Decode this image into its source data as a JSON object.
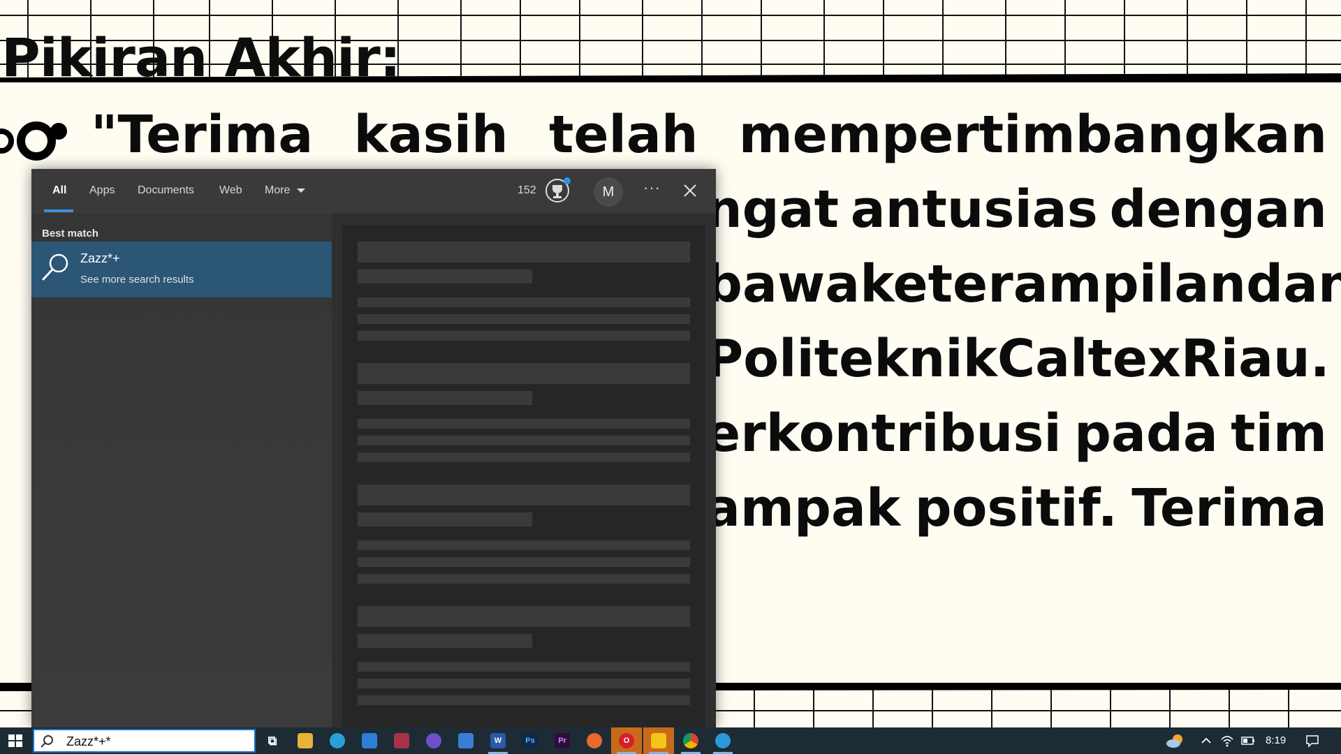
{
  "slide": {
    "heading": "Pikiran Akhir:",
    "line1": [
      "\"Terima",
      "kasih",
      "telah",
      "mempertimbangkan"
    ],
    "line2": [
      "ngat",
      "antusias",
      "dengan"
    ],
    "line3": [
      "bawa",
      "keterampilan",
      "dan"
    ],
    "line4": [
      "Politeknik",
      "Caltex",
      "Riau."
    ],
    "line5": [
      "erkontribusi",
      "pada",
      "tim"
    ],
    "line6": [
      "ampak",
      "positif.",
      "Terima"
    ]
  },
  "search_panel": {
    "tabs": [
      "All",
      "Apps",
      "Documents",
      "Web",
      "More"
    ],
    "points": "152",
    "avatar_initial": "M",
    "more_dots": "···",
    "best_match_label": "Best match",
    "result_title": "Zazz*+",
    "result_subtitle": "See more search results"
  },
  "taskbar": {
    "search_query": "Zazz*+*",
    "apps": [
      {
        "name": "task-view",
        "label": "⧉",
        "color": "#1d2b35"
      },
      {
        "name": "file-explorer",
        "label": "",
        "color": "#e8b23a"
      },
      {
        "name": "edge",
        "label": "",
        "color": "#2aa0d6"
      },
      {
        "name": "mail",
        "label": "",
        "color": "#2f7fd6"
      },
      {
        "name": "winrar",
        "label": "",
        "color": "#a8324a"
      },
      {
        "name": "media-player",
        "label": "",
        "color": "#6d4fc7"
      },
      {
        "name": "store",
        "label": "",
        "color": "#3a7dd6"
      },
      {
        "name": "word",
        "label": "W",
        "color": "#2a5aa8"
      },
      {
        "name": "photoshop",
        "label": "Ps",
        "color": "#0c2a4a"
      },
      {
        "name": "premiere",
        "label": "Pr",
        "color": "#2a0f3a"
      },
      {
        "name": "firefox",
        "label": "",
        "color": "#e66a2a"
      },
      {
        "name": "opera",
        "label": "O",
        "color": "#d4202a"
      },
      {
        "name": "sticky-notes",
        "label": "",
        "color": "#f5c518"
      },
      {
        "name": "chrome",
        "label": "",
        "color": "#3aa857"
      },
      {
        "name": "edge-beta",
        "label": "",
        "color": "#2a9ad6"
      }
    ],
    "time": "8:19"
  }
}
